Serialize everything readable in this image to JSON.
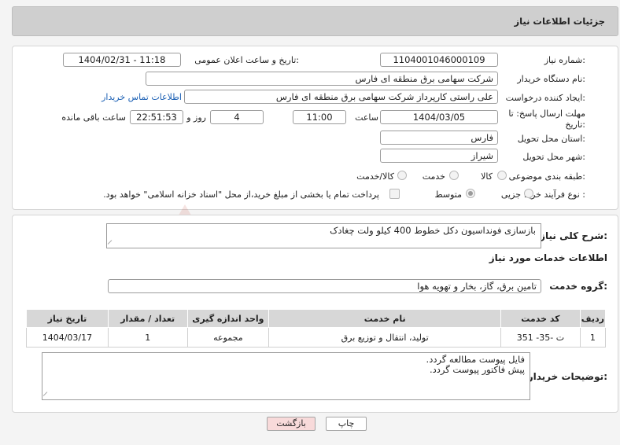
{
  "header": {
    "title": "جزئیات اطلاعات نیاز"
  },
  "form": {
    "need_number_label": "شماره نیاز:",
    "need_number": "1104001046000109",
    "announce_label": "تاریخ و ساعت اعلان عمومی:",
    "announce_value": "1404/02/31 - 11:18",
    "buyer_org_label": "نام دستگاه خریدار:",
    "buyer_org": "شرکت سهامی برق منطقه ای فارس",
    "creator_label": "ایجاد کننده درخواست:",
    "creator": "علی راستی کارپرداز شرکت سهامی برق منطقه ای فارس",
    "contact_link": "اطلاعات تماس خریدار",
    "deadline_label": "مهلت ارسال پاسخ: تا تاریخ:",
    "deadline_date": "1404/03/05",
    "time_label": "ساعت",
    "deadline_time": "11:00",
    "days_value": "4",
    "days_label": "روز و",
    "remaining_time": "22:51:53",
    "remaining_label": "ساعت باقی مانده",
    "province_label": "استان محل تحویل:",
    "province": "فارس",
    "city_label": "شهر محل تحویل:",
    "city": "شیراز",
    "category_label": "طبقه بندی موضوعی:",
    "category_options": [
      "کالا",
      "خدمت",
      "کالا/خدمت"
    ],
    "process_label": "نوع فرآیند خرید :",
    "process_options": [
      "جزیی",
      "متوسط"
    ],
    "payment_text": "پرداخت تمام یا بخشی از مبلغ خرید،از محل \"اسناد خزانه اسلامی\" خواهد بود."
  },
  "summary": {
    "label": "شرح کلی نیاز:",
    "text": "بازسازی فونداسیون دکل خطوط 400 کیلو ولت چغادک"
  },
  "services": {
    "section_title": "اطلاعات خدمات مورد نیاز",
    "group_label": "گروه خدمت:",
    "group_value": "تامین برق، گاز، بخار و تهویه هوا",
    "columns": [
      "ردیف",
      "کد خدمت",
      "نام خدمت",
      "واحد اندازه گیری",
      "تعداد / مقدار",
      "تاریخ نیاز"
    ],
    "rows": [
      {
        "row": "1",
        "code": "ت -35- 351",
        "name": "تولید، انتقال و توزیع برق",
        "unit": "مجموعه",
        "qty": "1",
        "date": "1404/03/17"
      }
    ]
  },
  "notes": {
    "label": "توضیحات خریدار:",
    "line1": "فایل پیوست مطالعه گردد.",
    "line2": "پیش فاکتور پیوست گردد."
  },
  "buttons": {
    "print": "چاپ",
    "back": "بازگشت"
  },
  "colors": {
    "back_button_bg": "#f8dada",
    "link": "#1a5fb4",
    "table_header": "#d7d7d7"
  }
}
